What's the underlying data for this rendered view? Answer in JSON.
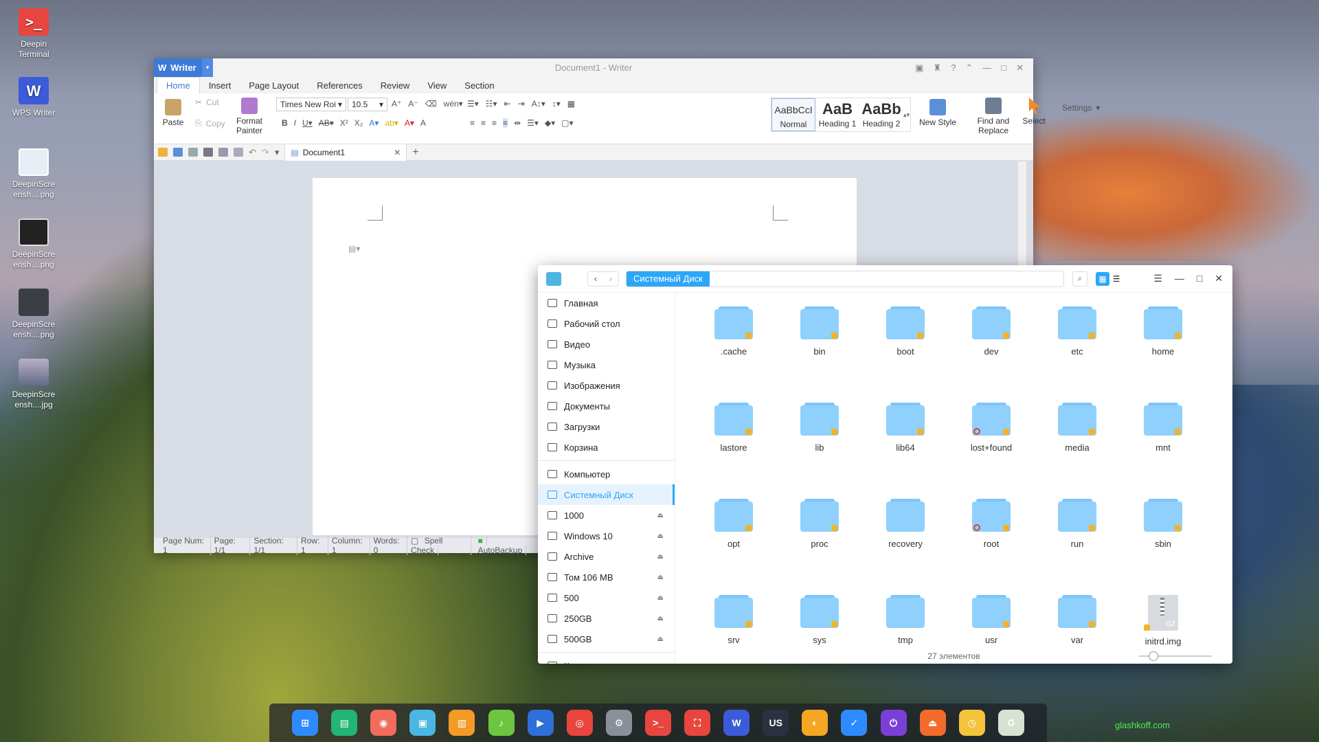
{
  "desktop": {
    "icons": [
      {
        "label": "Deepin Terminal",
        "glyph": ">_",
        "kind": "terminal-icon"
      },
      {
        "label": "WPS Writer",
        "glyph": "W",
        "kind": "wps-writer-icon"
      },
      {
        "label": "DeepinScre ensh....png",
        "glyph": "",
        "kind": "image-file-icon"
      },
      {
        "label": "DeepinScre ensh....png",
        "glyph": "",
        "kind": "image-file-icon"
      },
      {
        "label": "DeepinScre ensh....png",
        "glyph": "",
        "kind": "image-file-icon"
      },
      {
        "label": "DeepinScre ensh....jpg",
        "glyph": "",
        "kind": "image-file-icon"
      }
    ]
  },
  "writer": {
    "app_button": "Writer",
    "title": "Document1 - Writer",
    "tabs": [
      "Home",
      "Insert",
      "Page Layout",
      "References",
      "Review",
      "View",
      "Section"
    ],
    "active_tab": "Home",
    "ribbon": {
      "paste": "Paste",
      "cut": "Cut",
      "copy": "Copy",
      "format_painter": "Format Painter",
      "font_name": "Times New Roi",
      "font_size": "10.5",
      "styles": [
        {
          "preview": "AaBbCcI",
          "name": "Normal"
        },
        {
          "preview": "AaB",
          "name": "Heading 1"
        },
        {
          "preview": "AaBb",
          "name": "Heading 2"
        }
      ],
      "new_style": "New Style",
      "find_replace": "Find and Replace",
      "select": "Select",
      "settings": "Settings"
    },
    "doc_tab": "Document1",
    "status": {
      "page_num": "Page Num: 1",
      "page": "Page: 1/1",
      "section": "Section: 1/1",
      "row": "Row: 1",
      "column": "Column: 1",
      "words": "Words: 0",
      "spell": "Spell Check",
      "autobackup": "AutoBackup"
    }
  },
  "file_manager": {
    "breadcrumb": "Системный Диск",
    "sidebar": [
      {
        "label": "Главная",
        "icon": "home-icon"
      },
      {
        "label": "Рабочий стол",
        "icon": "desktop-icon"
      },
      {
        "label": "Видео",
        "icon": "video-icon"
      },
      {
        "label": "Музыка",
        "icon": "music-icon"
      },
      {
        "label": "Изображения",
        "icon": "pictures-icon"
      },
      {
        "label": "Документы",
        "icon": "documents-icon"
      },
      {
        "label": "Загрузки",
        "icon": "downloads-icon"
      },
      {
        "label": "Корзина",
        "icon": "trash-icon"
      },
      {
        "label": "Компьютер",
        "icon": "computer-icon"
      },
      {
        "label": "Системный Диск",
        "icon": "disk-icon"
      },
      {
        "label": "1000",
        "icon": "disk-icon"
      },
      {
        "label": "Windows 10",
        "icon": "disk-icon"
      },
      {
        "label": "Archive",
        "icon": "disk-icon"
      },
      {
        "label": "Том 106 MB",
        "icon": "disk-icon"
      },
      {
        "label": "500",
        "icon": "disk-icon"
      },
      {
        "label": "250GB",
        "icon": "usb-icon"
      },
      {
        "label": "500GB",
        "icon": "usb-icon"
      },
      {
        "label": "Компьютеры в сети",
        "icon": "network-icon"
      }
    ],
    "items": [
      {
        "name": ".cache",
        "locked": true,
        "noaccess": false
      },
      {
        "name": "bin",
        "locked": true,
        "noaccess": false
      },
      {
        "name": "boot",
        "locked": true,
        "noaccess": false
      },
      {
        "name": "dev",
        "locked": true,
        "noaccess": false
      },
      {
        "name": "etc",
        "locked": true,
        "noaccess": false
      },
      {
        "name": "home",
        "locked": true,
        "noaccess": false
      },
      {
        "name": "lastore",
        "locked": true,
        "noaccess": false
      },
      {
        "name": "lib",
        "locked": true,
        "noaccess": false
      },
      {
        "name": "lib64",
        "locked": true,
        "noaccess": false
      },
      {
        "name": "lost+found",
        "locked": true,
        "noaccess": true
      },
      {
        "name": "media",
        "locked": true,
        "noaccess": false
      },
      {
        "name": "mnt",
        "locked": true,
        "noaccess": false
      },
      {
        "name": "opt",
        "locked": true,
        "noaccess": false
      },
      {
        "name": "proc",
        "locked": true,
        "noaccess": false
      },
      {
        "name": "recovery",
        "locked": false,
        "noaccess": false
      },
      {
        "name": "root",
        "locked": true,
        "noaccess": true
      },
      {
        "name": "run",
        "locked": true,
        "noaccess": false
      },
      {
        "name": "sbin",
        "locked": true,
        "noaccess": false
      },
      {
        "name": "srv",
        "locked": true,
        "noaccess": false
      },
      {
        "name": "sys",
        "locked": true,
        "noaccess": false
      },
      {
        "name": "tmp",
        "locked": false,
        "noaccess": false
      },
      {
        "name": "usr",
        "locked": true,
        "noaccess": false
      },
      {
        "name": "var",
        "locked": true,
        "noaccess": false
      },
      {
        "name": "initrd.img",
        "locked": true,
        "noaccess": false,
        "archive": true,
        "badge": "GZ"
      }
    ],
    "status": "27 элементов"
  },
  "dock": [
    {
      "name": "launcher-icon",
      "color": "#2e8bff",
      "glyph": "⊞"
    },
    {
      "name": "multitasking-icon",
      "color": "#22b573",
      "glyph": "▤"
    },
    {
      "name": "screen-recorder-icon",
      "color": "#f26b5b",
      "glyph": "◉"
    },
    {
      "name": "file-manager-icon",
      "color": "#4bb6e3",
      "glyph": "▣"
    },
    {
      "name": "app-store-icon",
      "color": "#f39a27",
      "glyph": "▥"
    },
    {
      "name": "music-icon",
      "color": "#6dc63f",
      "glyph": "♪"
    },
    {
      "name": "movie-icon",
      "color": "#2f6fd9",
      "glyph": "▶"
    },
    {
      "name": "chrome-icon",
      "color": "#e8453c",
      "glyph": "◎"
    },
    {
      "name": "settings-icon",
      "color": "#8a8f99",
      "glyph": "⚙"
    },
    {
      "name": "terminal-icon",
      "color": "#e7463f",
      "glyph": ">_"
    },
    {
      "name": "screenshot-icon",
      "color": "#e8453c",
      "glyph": "⛶"
    },
    {
      "name": "wps-writer-icon",
      "color": "#3b5bd9",
      "glyph": "W"
    },
    {
      "name": "keyboard-layout-icon",
      "color": "#2a3242",
      "glyph": "US"
    },
    {
      "name": "rss-icon",
      "color": "#f5a623",
      "glyph": "◐"
    },
    {
      "name": "calendar-icon",
      "color": "#2e8bff",
      "glyph": "✓"
    },
    {
      "name": "power-icon",
      "color": "#7b3fd9",
      "glyph": "⏻"
    },
    {
      "name": "eject-icon",
      "color": "#f26b2b",
      "glyph": "⏏"
    },
    {
      "name": "clock-icon",
      "color": "#f5c33b",
      "glyph": "◷"
    },
    {
      "name": "trash-icon",
      "color": "#d7e2d2",
      "glyph": "♻"
    }
  ],
  "watermark": "glashkoff.com"
}
